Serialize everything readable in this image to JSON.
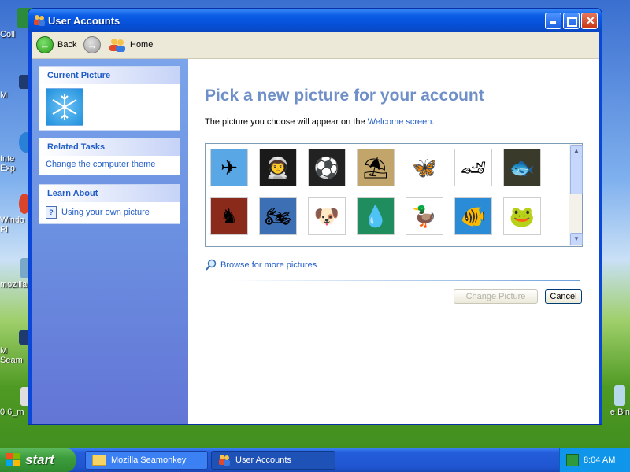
{
  "desktop": {
    "left_labels": [
      "Coll",
      "M",
      "Inte\nExp",
      "Windo\nPl",
      "mozilla",
      "M\nSeam",
      "0.6_m"
    ],
    "right_label": "e Bin"
  },
  "window": {
    "title": "User Accounts",
    "toolbar": {
      "back_label": "Back",
      "home_label": "Home"
    }
  },
  "sidebar": {
    "current_picture_title": "Current Picture",
    "related_tasks_title": "Related Tasks",
    "related_tasks_items": [
      "Change the computer theme"
    ],
    "learn_about_title": "Learn About",
    "learn_about_items": [
      "Using your own picture"
    ]
  },
  "main": {
    "heading": "Pick a new picture for your account",
    "subtext_prefix": "The picture you choose will appear on the ",
    "subtext_link": "Welcome screen",
    "subtext_suffix": ".",
    "pictures": [
      {
        "name": "airplane-picture",
        "glyph": "✈",
        "bg": "#5aa7e6"
      },
      {
        "name": "astronaut-picture",
        "glyph": "👨‍🚀",
        "bg": "#1a1a1a"
      },
      {
        "name": "soccer-ball-picture",
        "glyph": "⚽",
        "bg": "#222222"
      },
      {
        "name": "beach-chairs-picture",
        "glyph": "⛱",
        "bg": "#c2a56a"
      },
      {
        "name": "butterfly-picture",
        "glyph": "🦋",
        "bg": "#ffffff"
      },
      {
        "name": "car-picture",
        "glyph": "🏎",
        "bg": "#ffffff"
      },
      {
        "name": "fish-face-picture",
        "glyph": "🐟",
        "bg": "#3a3a2a"
      },
      {
        "name": "chess-picture",
        "glyph": "♞",
        "bg": "#8a2a1a"
      },
      {
        "name": "dirt-bike-picture",
        "glyph": "🏍",
        "bg": "#3d6fb4"
      },
      {
        "name": "dog-picture",
        "glyph": "🐶",
        "bg": "#ffffff"
      },
      {
        "name": "drip-picture",
        "glyph": "💧",
        "bg": "#1f8d5e"
      },
      {
        "name": "duck-picture",
        "glyph": "🦆",
        "bg": "#ffffff"
      },
      {
        "name": "tropical-fish-picture",
        "glyph": "🐠",
        "bg": "#2a8bd6"
      },
      {
        "name": "frog-picture",
        "glyph": "🐸",
        "bg": "#ffffff"
      }
    ],
    "browse_label": "Browse for more pictures",
    "change_button": "Change Picture",
    "cancel_button": "Cancel"
  },
  "taskbar": {
    "start_label": "start",
    "tasks": [
      "Mozilla Seamonkey",
      "User Accounts"
    ],
    "clock": "8:04 AM"
  }
}
